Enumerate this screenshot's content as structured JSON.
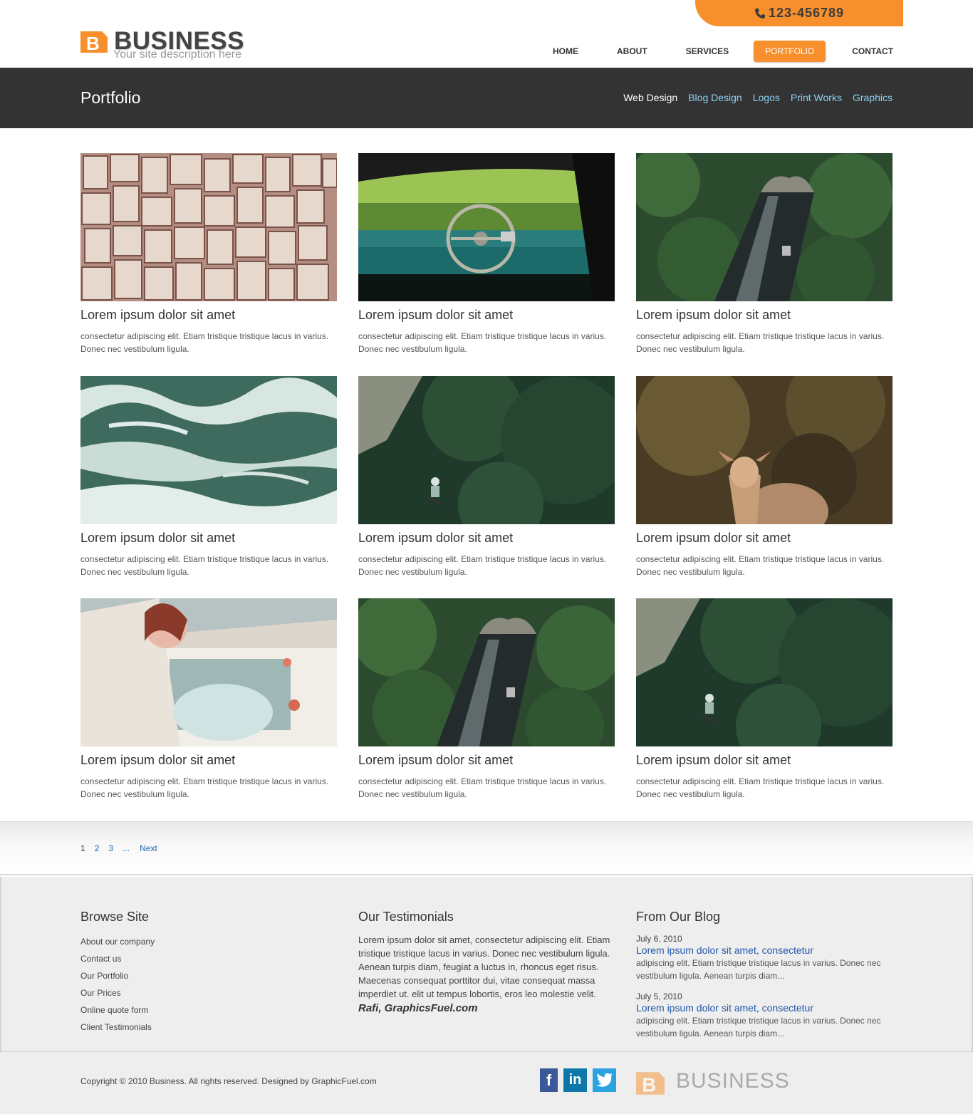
{
  "header": {
    "phone": "123-456789",
    "logo_title": "BUSINESS",
    "logo_tagline": "Your site description here",
    "nav": [
      "HOME",
      "ABOUT",
      "SERVICES",
      "PORTFOLIO",
      "CONTACT"
    ],
    "active_nav": "PORTFOLIO"
  },
  "titlebar": {
    "title": "Portfolio",
    "filters": [
      "Web Design",
      "Blog Design",
      "Logos",
      "Print Works",
      "Graphics"
    ],
    "active_filter": "Web Design"
  },
  "portfolio": {
    "items": [
      {
        "title": "Lorem ipsum dolor sit amet",
        "desc": "consectetur adipiscing elit. Etiam tristique tristique lacus in varius. Donec nec vestibulum ligula.",
        "image": "books"
      },
      {
        "title": "Lorem ipsum dolor sit amet",
        "desc": "consectetur adipiscing elit. Etiam tristique tristique lacus in varius. Donec nec vestibulum ligula.",
        "image": "car-interior"
      },
      {
        "title": "Lorem ipsum dolor sit amet",
        "desc": "consectetur adipiscing elit. Etiam tristique tristique lacus in varius. Donec nec vestibulum ligula.",
        "image": "forest-tunnel"
      },
      {
        "title": "Lorem ipsum dolor sit amet",
        "desc": "consectetur adipiscing elit. Etiam tristique tristique lacus in varius. Donec nec vestibulum ligula.",
        "image": "ocean-waves"
      },
      {
        "title": "Lorem ipsum dolor sit amet",
        "desc": "consectetur adipiscing elit. Etiam tristique tristique lacus in varius. Donec nec vestibulum ligula.",
        "image": "forest-cyclist"
      },
      {
        "title": "Lorem ipsum dolor sit amet",
        "desc": "consectetur adipiscing elit. Etiam tristique tristique lacus in varius. Donec nec vestibulum ligula.",
        "image": "deer"
      },
      {
        "title": "Lorem ipsum dolor sit amet",
        "desc": "consectetur adipiscing elit. Etiam tristique tristique lacus in varius. Donec nec vestibulum ligula.",
        "image": "wedding-car"
      },
      {
        "title": "Lorem ipsum dolor sit amet",
        "desc": "consectetur adipiscing elit. Etiam tristique tristique lacus in varius. Donec nec vestibulum ligula.",
        "image": "forest-tunnel"
      },
      {
        "title": "Lorem ipsum dolor sit amet",
        "desc": "consectetur adipiscing elit. Etiam tristique tristique lacus in varius. Donec nec vestibulum ligula.",
        "image": "forest-cyclist"
      }
    ]
  },
  "pagination": {
    "pages": [
      "1",
      "2",
      "3"
    ],
    "current": "1",
    "ellipsis": "...",
    "next": "Next"
  },
  "footer": {
    "browse": {
      "heading": "Browse Site",
      "links": [
        "About our company",
        "Contact us",
        "Our Portfolio",
        "Our Prices",
        "Online quote form",
        "Client Testimonials"
      ]
    },
    "testimonials": {
      "heading": "Our Testimonials",
      "text": "Lorem ipsum dolor sit amet, consectetur adipiscing elit. Etiam tristique tristique lacus in varius. Donec nec vestibulum ligula. Aenean turpis diam, feugiat a luctus in, rhoncus eget risus. Maecenas consequat porttitor dui, vitae consequat massa imperdiet ut. elit ut tempus lobortis, eros leo molestie velit.",
      "author": "Rafi, GraphicsFuel.com"
    },
    "blog": {
      "heading": "From Our Blog",
      "posts": [
        {
          "date": "July 6, 2010",
          "title": "Lorem ipsum dolor sit amet, consectetur",
          "excerpt": "adipiscing elit. Etiam tristique tristique lacus in varius. Donec nec vestibulum ligula. Aenean turpis diam..."
        },
        {
          "date": "July 5, 2010",
          "title": "Lorem ipsum dolor sit amet, consectetur",
          "excerpt": "adipiscing elit. Etiam tristique tristique lacus in varius. Donec nec vestibulum ligula. Aenean turpis diam..."
        }
      ]
    },
    "copyright": "Copyright © 2010 Business. All rights reserved. Designed by GraphicFuel.com",
    "social": {
      "facebook": "f",
      "linkedin": "in"
    },
    "logo_title": "BUSINESS"
  },
  "colors": {
    "accent": "#f7902c",
    "titlebar": "#333333",
    "link": "#2255aa",
    "filter_link": "#8fd0f2"
  }
}
